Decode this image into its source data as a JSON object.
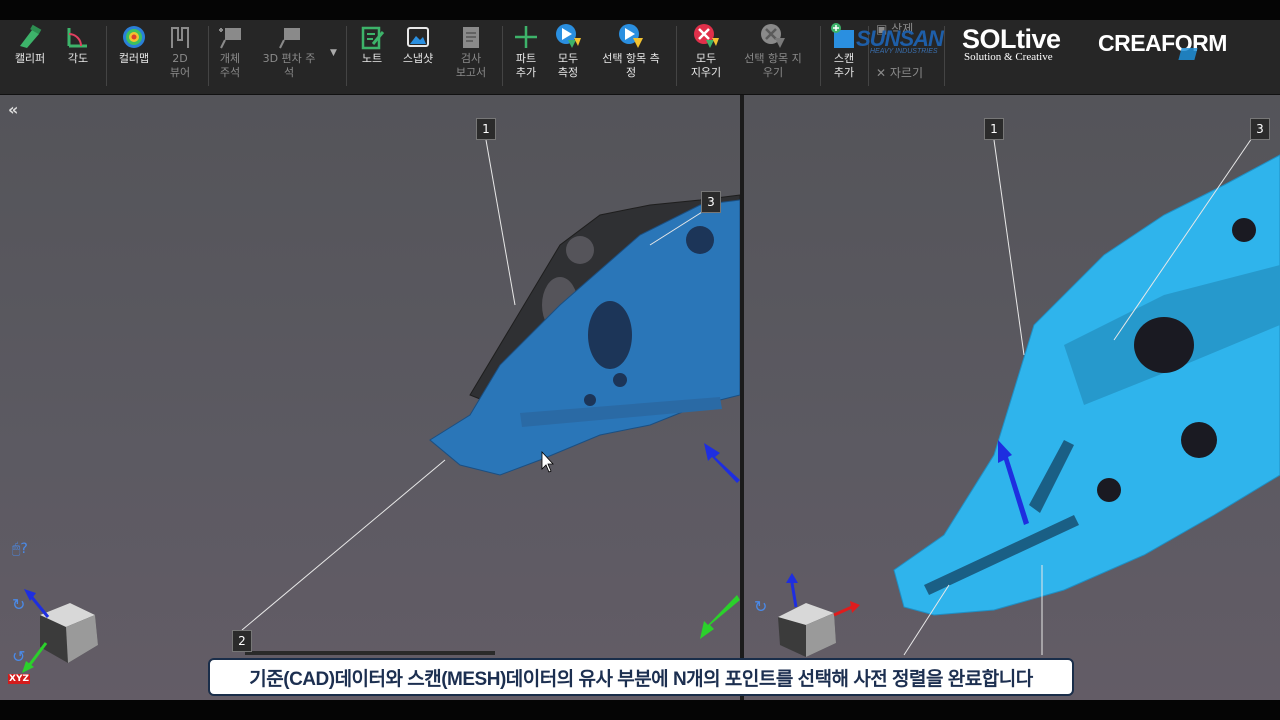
{
  "toolbar": {
    "caliper": "캘리퍼",
    "angle": "각도",
    "colormap": "컬러맵",
    "viewer2d_line1": "2D",
    "viewer2d_line2": "뷰어",
    "object_annot_line1": "개체",
    "object_annot_line2": "주석",
    "deviation3d_line1": "3D 편차 주",
    "deviation3d_line2": "석",
    "note": "노트",
    "snapshot": "스냅샷",
    "report_line1": "검사",
    "report_line2": "보고서",
    "add_part_line1": "파트",
    "add_part_line2": "추가",
    "measure_all_line1": "모두",
    "measure_all_line2": "측정",
    "measure_sel_line1": "선택 항목 측",
    "measure_sel_line2": "정",
    "clear_all_line1": "모두",
    "clear_all_line2": "지우기",
    "clear_sel_line1": "선택 항목 지",
    "clear_sel_line2": "우기",
    "add_scan_line1": "스캔",
    "add_scan_line2": "추가",
    "delete": "삭제",
    "cut": "자르기"
  },
  "logos": {
    "sunsan": "SUNSAN",
    "sunsan_sub": "HEAVY INDUSTRIES",
    "soltive": "SOLtive",
    "soltive_sub": "Solution & Creative",
    "creaform": "CREAFORM"
  },
  "left_view": {
    "markers": [
      "1",
      "2",
      "3"
    ],
    "axis_label": "XYZ"
  },
  "right_view": {
    "markers": [
      "1",
      "3"
    ]
  },
  "caption": "기준(CAD)데이터와 스캔(MESH)데이터의 유사 부분에 N개의 포인트를 선택해 사전 정렬을 완료합니다",
  "colors": {
    "scan_blue": "#2fb4ec",
    "cad_dark": "#2f3033",
    "left_blue": "#2a76b8",
    "caption_text": "#1c2f50"
  }
}
